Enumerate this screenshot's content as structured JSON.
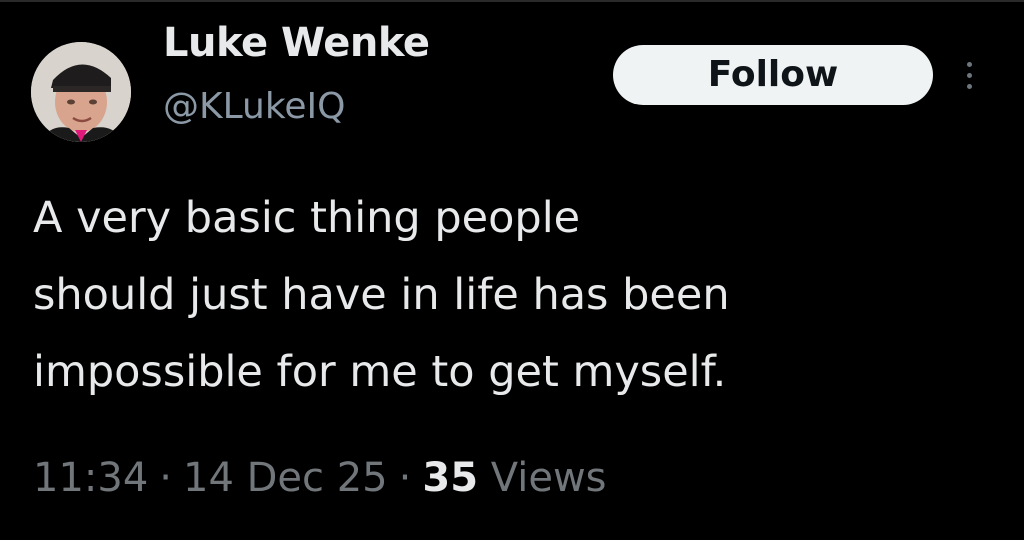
{
  "author": {
    "display_name": "Luke Wenke",
    "handle": "@KLukeIQ"
  },
  "actions": {
    "follow_label": "Follow",
    "more_icon": "more-vertical-icon"
  },
  "tweet": {
    "lines": [
      "A very basic thing people",
      "should just have in life has been",
      "impossible for me to get myself."
    ]
  },
  "meta": {
    "time": "11:34",
    "separator": "·",
    "date": "14 Dec 25",
    "views_count": "35",
    "views_label": "Views"
  },
  "colors": {
    "background": "#000000",
    "primary_text": "#e7e9ea",
    "secondary_text": "#71767b",
    "follow_bg": "#eff3f4"
  }
}
